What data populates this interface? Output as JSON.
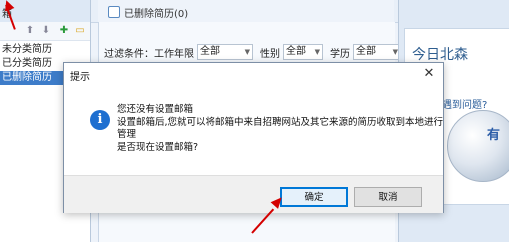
{
  "sidebar": {
    "title": "箱",
    "items": [
      "未分类简历",
      "已分类简历",
      "已删除简历"
    ],
    "toolbar_icons": [
      "arrow-up-icon",
      "arrow-down-icon",
      "add-icon",
      "folder-icon"
    ]
  },
  "main": {
    "tab_title": "已删除简历(0)",
    "filter": {
      "label": "过滤条件：工作年限",
      "work_years": "全部",
      "gender_label": "性别",
      "gender": "全部",
      "education_label": "学历",
      "education": "全部"
    }
  },
  "right_panel": {
    "banner": "今日北森",
    "help_text": "使用遇到问题?",
    "globe_text": "有"
  },
  "dialog": {
    "title": "提示",
    "close_glyph": "✕",
    "lines": [
      "您还没有设置邮箱",
      "设置邮箱后,您就可以将邮箱中来自招聘网站及其它来源的简历收取到本地进行",
      "管理",
      "是否现在设置邮箱?"
    ],
    "ok_label": "确定",
    "cancel_label": "取消"
  },
  "colors": {
    "selection": "#3d7cc9",
    "info_icon": "#1e6fd0",
    "annotation_arrow": "#d40000",
    "default_button_border": "#0078d7"
  }
}
